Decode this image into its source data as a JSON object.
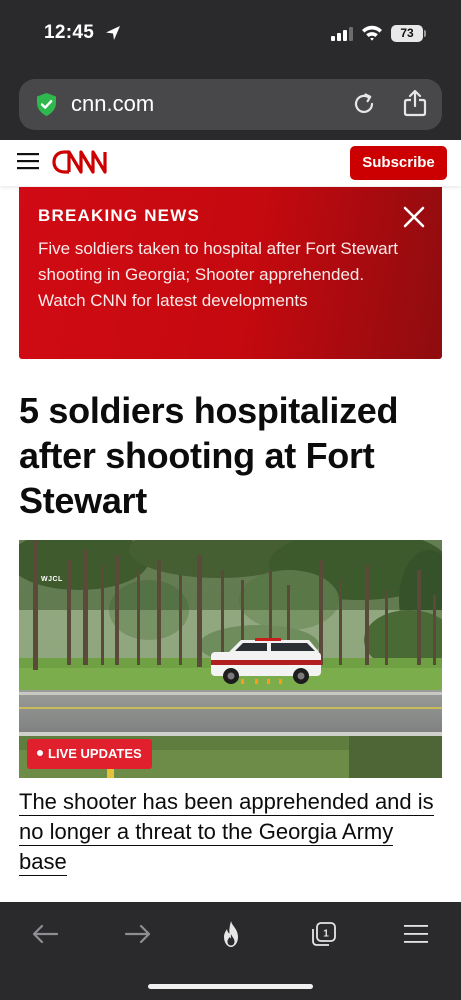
{
  "status_bar": {
    "time": "12:45",
    "battery": "73",
    "icons": [
      "location-arrow-icon",
      "cell-signal-icon",
      "wifi-icon",
      "battery-icon"
    ]
  },
  "browser": {
    "url": "cnn.com",
    "icons": [
      "shield-icon",
      "reload-icon",
      "share-icon"
    ]
  },
  "site_header": {
    "logo": "CNN",
    "subscribe_label": "Subscribe"
  },
  "breaking_news": {
    "title": "BREAKING NEWS",
    "body": "Five soldiers taken to hospital after Fort Stewart shooting in Georgia; Shooter apprehended. Watch CNN for latest developments"
  },
  "article": {
    "headline": "5 soldiers hospitalized after shooting at Fort Stewart",
    "image_watermark": "WJCL",
    "live_badge": "LIVE UPDATES",
    "link_text": "The shooter has been apprehended and is no longer a threat to the Georgia Army base"
  },
  "toolbar": {
    "icons": [
      "back-arrow-icon",
      "forward-arrow-icon",
      "flame-icon",
      "tabs-icon",
      "menu-icon"
    ],
    "tab_count": "1"
  },
  "colors": {
    "cnn_red": "#cc0000",
    "chrome_dark": "#2a2a2c",
    "address_bar": "#48484b",
    "live_red": "#e0202d"
  }
}
